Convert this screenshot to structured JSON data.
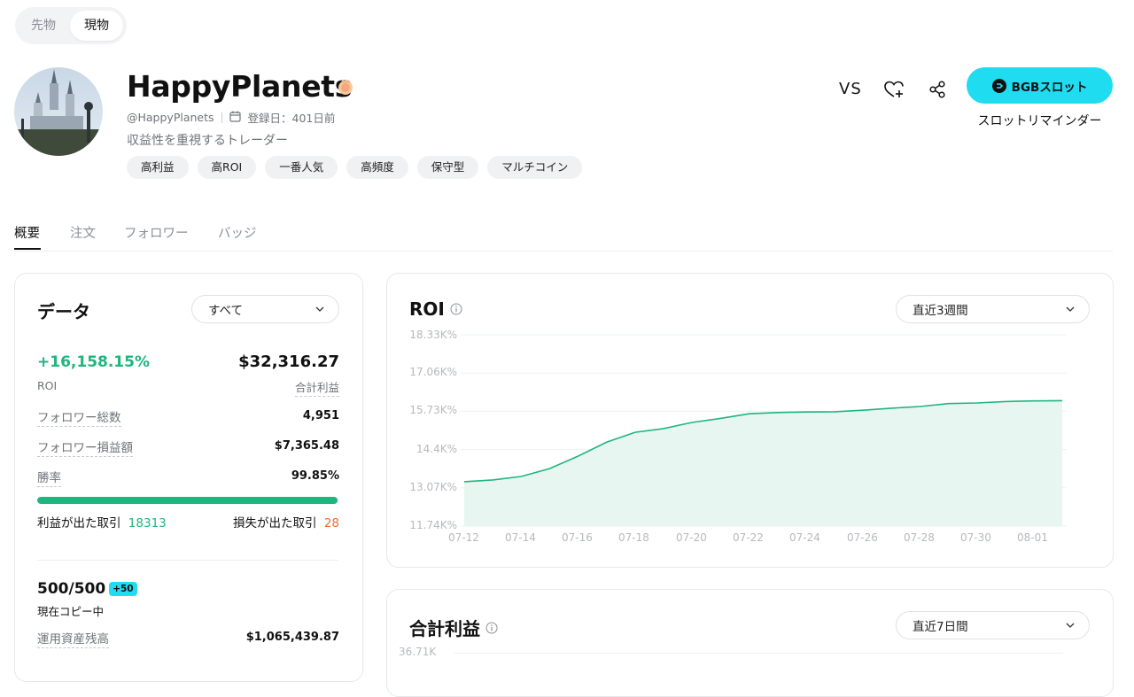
{
  "market_switch": {
    "futures": "先物",
    "spot": "現物"
  },
  "profile": {
    "name": "HappyPlanets",
    "handle": "@HappyPlanets",
    "joined": "登録日：401日前",
    "bio": "収益性を重視するトレーダー",
    "tags": [
      "高利益",
      "高ROI",
      "一番人気",
      "高頻度",
      "保守型",
      "マルチコイン"
    ]
  },
  "actions": {
    "vs": "VS",
    "slot_button": "BGBスロット",
    "slot_reminder": "スロットリマインダー"
  },
  "tabs": [
    "概要",
    "注文",
    "フォロワー",
    "バッジ"
  ],
  "data_card": {
    "title": "データ",
    "filter": "すべて",
    "roi_value": "+16,158.15%",
    "roi_label": "ROI",
    "pnl_value": "$32,316.27",
    "pnl_label": "合計利益",
    "rows": [
      {
        "label": "フォロワー総数",
        "value": "4,951"
      },
      {
        "label": "フォロワー損益額",
        "value": "$7,365.48"
      },
      {
        "label": "勝率",
        "value": "99.85%"
      }
    ],
    "win_rate": 0.9985,
    "profit_trades_label": "利益が出た取引",
    "profit_trades": "18313",
    "loss_trades_label": "損失が出た取引",
    "loss_trades": "28",
    "copy_count": "500/500",
    "copy_badge": "+50",
    "copy_label": "現在コピー中",
    "aum_label": "運用資産残高",
    "aum_value": "$1,065,439.87"
  },
  "roi_chart": {
    "title": "ROI",
    "period": "直近3週間",
    "y_ticks": [
      "18.33K%",
      "17.06K%",
      "15.73K%",
      "14.4K%",
      "13.07K%",
      "11.74K%"
    ],
    "x_ticks": [
      "07-12",
      "07-14",
      "07-16",
      "07-18",
      "07-20",
      "07-22",
      "07-24",
      "07-26",
      "07-28",
      "07-30",
      "08-01"
    ]
  },
  "pnl_chart": {
    "title": "合計利益",
    "period": "直近7日間",
    "y_top": "36.71K"
  },
  "chart_data": {
    "type": "area",
    "title": "ROI",
    "x": [
      "07-12",
      "07-13",
      "07-14",
      "07-15",
      "07-16",
      "07-17",
      "07-18",
      "07-19",
      "07-20",
      "07-21",
      "07-22",
      "07-23",
      "07-24",
      "07-25",
      "07-26",
      "07-27",
      "07-28",
      "07-29",
      "07-30",
      "07-31",
      "08-01",
      "08-02"
    ],
    "series": [
      {
        "values": [
          13.27,
          13.33,
          13.45,
          13.72,
          14.15,
          14.63,
          14.97,
          15.1,
          15.31,
          15.45,
          15.61,
          15.65,
          15.67,
          15.68,
          15.73,
          15.8,
          15.86,
          15.96,
          15.98,
          16.03,
          16.05,
          16.06
        ]
      }
    ],
    "y_unit": "K%",
    "ylim": [
      11.74,
      18.33
    ],
    "grid": true,
    "color": "#1fb57f"
  }
}
